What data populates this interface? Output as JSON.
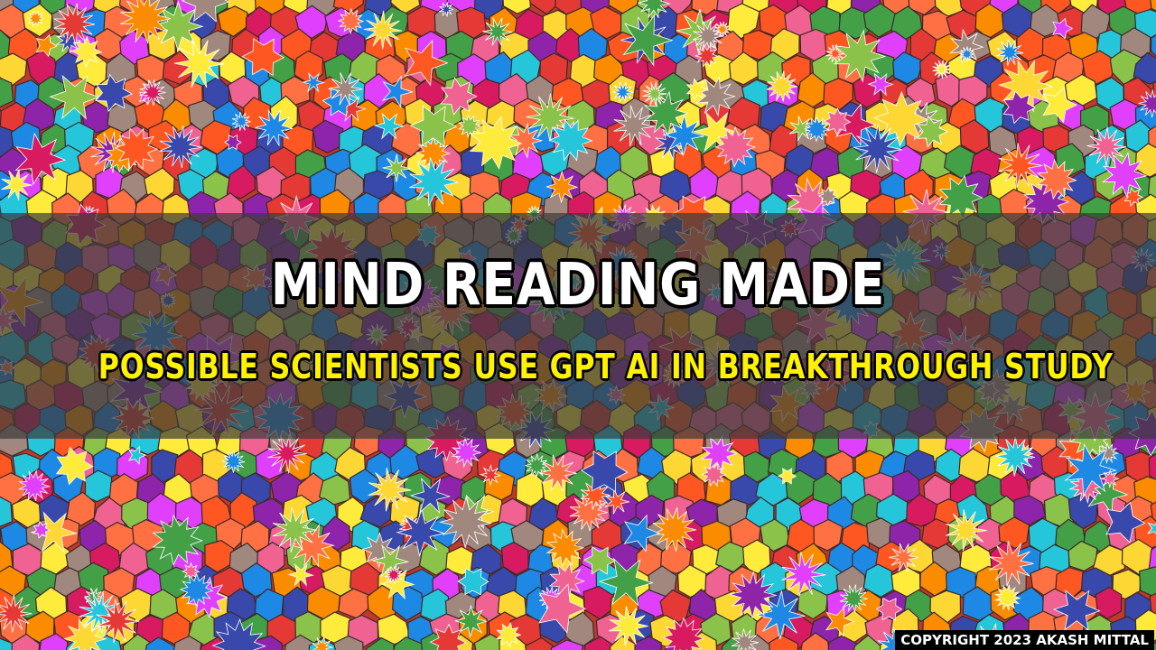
{
  "banner": {
    "title": "MIND READING MADE",
    "subtitle": "POSSIBLE SCIENTISTS USE GPT AI IN BREAKTHROUGH STUDY"
  },
  "footer": {
    "copyright": "COPYRIGHT 2023 AKASH MITTAL"
  },
  "colors": {
    "title_text": "#ffffff",
    "subtitle_text": "#fff200",
    "band_overlay": "#3c3c3c",
    "copyright_bg": "#000000",
    "mosaic_palette": [
      "#e53935",
      "#ff7043",
      "#fb8c00",
      "#fdd835",
      "#ffeb3b",
      "#8bc34a",
      "#43a047",
      "#26c6da",
      "#1e88e5",
      "#3949ab",
      "#8e24aa",
      "#e040fb",
      "#f06292",
      "#d81b60",
      "#a1887f",
      "#ff5722"
    ]
  },
  "background": {
    "kind": "colorful stained-glass mosaic with star and flower shapes"
  }
}
